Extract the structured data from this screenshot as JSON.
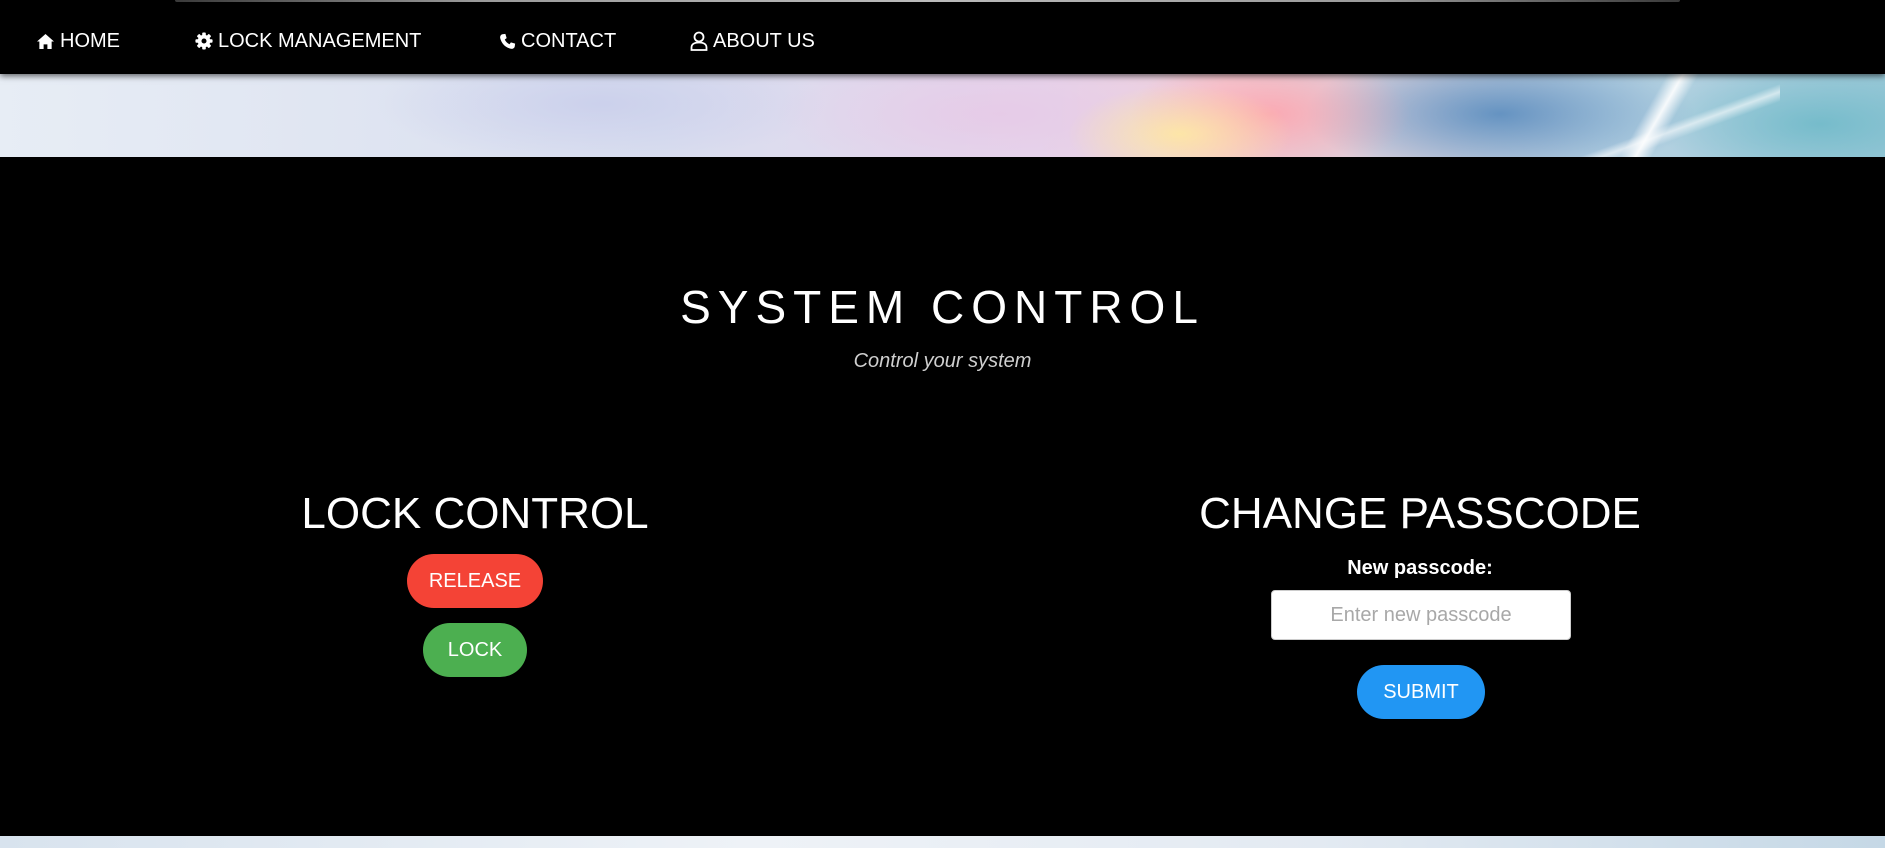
{
  "nav": {
    "items": [
      {
        "label": "HOME",
        "icon": "home-icon"
      },
      {
        "label": "LOCK MANAGEMENT",
        "icon": "gear-icon"
      },
      {
        "label": "CONTACT",
        "icon": "phone-icon"
      },
      {
        "label": "ABOUT US",
        "icon": "user-icon"
      }
    ]
  },
  "main": {
    "title": "SYSTEM CONTROL",
    "subtitle": "Control your system"
  },
  "lock_control": {
    "title": "LOCK CONTROL",
    "release_label": "RELEASE",
    "lock_label": "LOCK"
  },
  "change_passcode": {
    "title": "CHANGE PASSCODE",
    "field_label": "New passcode:",
    "placeholder": "Enter new passcode",
    "value": "",
    "submit_label": "SUBMIT"
  },
  "colors": {
    "release": "#f44336",
    "lock": "#4caf50",
    "submit": "#2196f3",
    "background": "#000000"
  }
}
